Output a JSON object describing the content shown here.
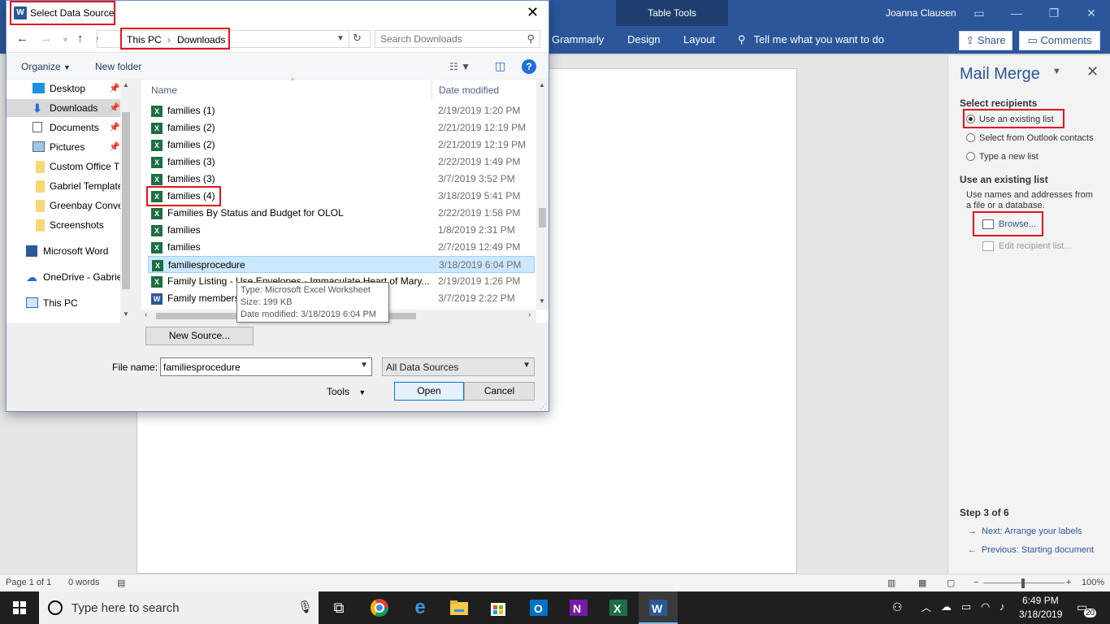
{
  "word": {
    "table_tools": "Table Tools",
    "user": "Joanna Clausen",
    "tabs": [
      "Grammarly",
      "Design",
      "Layout"
    ],
    "tell_me": "Tell me what you want to do",
    "share": "Share",
    "comments": "Comments"
  },
  "pane": {
    "title": "Mail Merge",
    "select_recipients": "Select recipients",
    "options": [
      "Use an existing list",
      "Select from Outlook contacts",
      "Type a new list"
    ],
    "selected_option": "Use an existing list",
    "use_existing_heading": "Use an existing list",
    "description": "Use names and addresses from a file or a database.",
    "browse": "Browse...",
    "edit_list": "Edit recipient list...",
    "step": "Step 3 of 6",
    "next": "Next: Arrange your labels",
    "previous": "Previous: Starting document"
  },
  "status": {
    "page": "Page 1 of 1",
    "words": "0 words",
    "zoom": "100%"
  },
  "taskbar": {
    "search_placeholder": "Type here to search",
    "time": "6:49 PM",
    "date": "3/18/2019",
    "notifications": "20"
  },
  "dialog": {
    "title": "Select Data Source",
    "breadcrumb": [
      "This PC",
      "Downloads"
    ],
    "search_placeholder": "Search Downloads",
    "organize": "Organize",
    "new_folder": "New folder",
    "nav_items": [
      {
        "label": "Desktop",
        "pinned": true
      },
      {
        "label": "Downloads",
        "pinned": true
      },
      {
        "label": "Documents",
        "pinned": true
      },
      {
        "label": "Pictures",
        "pinned": true
      },
      {
        "label": "Custom Office T",
        "pinned": false
      },
      {
        "label": "Gabriel Template",
        "pinned": false
      },
      {
        "label": "Greenbay Conve",
        "pinned": false
      },
      {
        "label": "Screenshots",
        "pinned": false
      },
      {
        "label": "Microsoft Word",
        "pinned": false
      },
      {
        "label": "OneDrive - Gabrie",
        "pinned": false
      },
      {
        "label": "This PC",
        "pinned": false
      }
    ],
    "columns": {
      "name": "Name",
      "date": "Date modified"
    },
    "files": [
      {
        "name": "families (1)",
        "date": "2/19/2019 1:20 PM",
        "type": "excel"
      },
      {
        "name": "families (2)",
        "date": "2/21/2019 12:19 PM",
        "type": "excel"
      },
      {
        "name": "families (2)",
        "date": "2/21/2019 12:19 PM",
        "type": "excel"
      },
      {
        "name": "families (3)",
        "date": "2/22/2019 1:49 PM",
        "type": "excel"
      },
      {
        "name": "families (3)",
        "date": "3/7/2019 3:52 PM",
        "type": "excel"
      },
      {
        "name": "families (4)",
        "date": "3/18/2019 5:41 PM",
        "type": "excel"
      },
      {
        "name": "Families By Status and Budget for OLOL",
        "date": "2/22/2019 1:58 PM",
        "type": "excel"
      },
      {
        "name": "families",
        "date": "1/8/2019 2:31 PM",
        "type": "excel"
      },
      {
        "name": "families",
        "date": "2/7/2019 12:49 PM",
        "type": "excel"
      },
      {
        "name": "familiesprocedure",
        "date": "3/18/2019 6:04 PM",
        "type": "excel"
      },
      {
        "name": "Family Listing - Use Envelopes - Immaculate Heart of Mary...",
        "date": "2/19/2019 1:26 PM",
        "type": "excel"
      },
      {
        "name": "Family members",
        "date": "3/7/2019 2:22 PM",
        "type": "word"
      }
    ],
    "tooltip": {
      "type": "Type: Microsoft Excel Worksheet",
      "size": "Size: 199 KB",
      "modified": "Date modified: 3/18/2019 6:04 PM"
    },
    "new_source": "New Source...",
    "file_name_label": "File name:",
    "file_name_value": "familiesprocedure",
    "filter": "All Data Sources",
    "tools": "Tools",
    "open": "Open",
    "cancel": "Cancel"
  },
  "colors": {
    "word_blue": "#2b579a",
    "highlight_red": "#e0141e",
    "selection": "#cce8ff"
  }
}
